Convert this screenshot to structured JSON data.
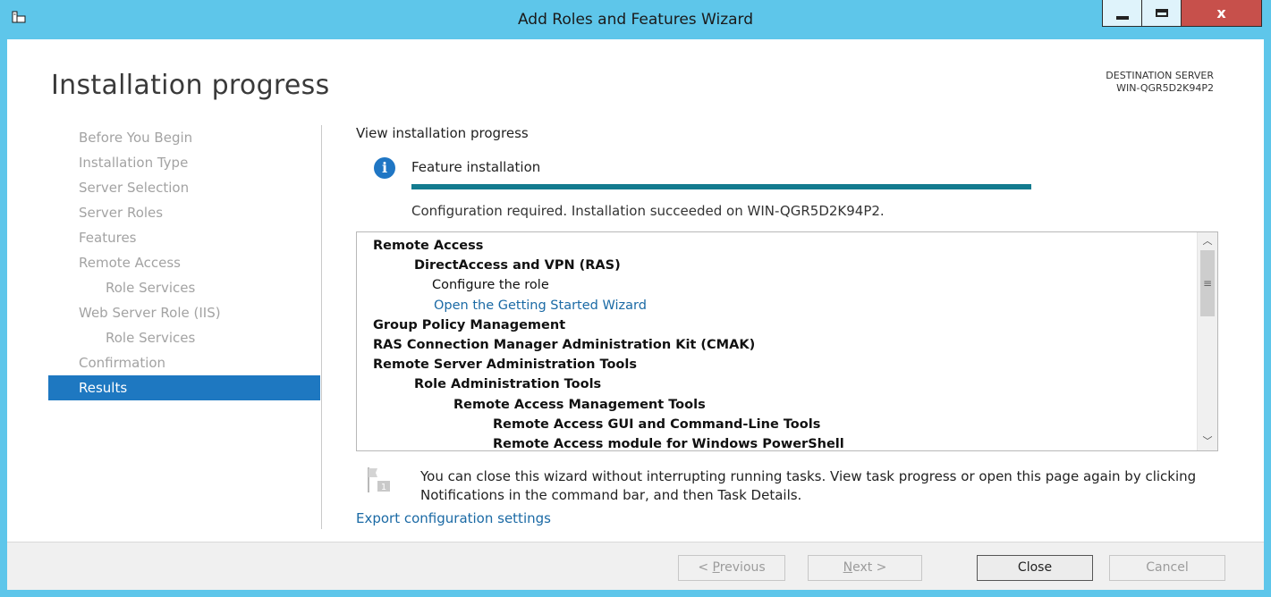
{
  "window": {
    "title": "Add Roles and Features Wizard",
    "close_glyph": "x"
  },
  "header": {
    "page_title": "Installation progress",
    "destination_label": "DESTINATION SERVER",
    "destination_server": "WIN-QGR5D2K94P2"
  },
  "sidebar": {
    "items": [
      {
        "label": "Before You Begin",
        "level": 0,
        "active": false
      },
      {
        "label": "Installation Type",
        "level": 0,
        "active": false
      },
      {
        "label": "Server Selection",
        "level": 0,
        "active": false
      },
      {
        "label": "Server Roles",
        "level": 0,
        "active": false
      },
      {
        "label": "Features",
        "level": 0,
        "active": false
      },
      {
        "label": "Remote Access",
        "level": 0,
        "active": false
      },
      {
        "label": "Role Services",
        "level": 1,
        "active": false
      },
      {
        "label": "Web Server Role (IIS)",
        "level": 0,
        "active": false
      },
      {
        "label": "Role Services",
        "level": 1,
        "active": false
      },
      {
        "label": "Confirmation",
        "level": 0,
        "active": false
      },
      {
        "label": "Results",
        "level": 0,
        "active": true
      }
    ]
  },
  "main": {
    "heading": "View installation progress",
    "info_icon": "info-icon",
    "feature_label": "Feature installation",
    "progress_fraction": 1.0,
    "status_text": "Configuration required. Installation succeeded on WIN-QGR5D2K94P2.",
    "results": [
      {
        "text": "Remote Access",
        "level": 0,
        "bold": true,
        "link": false
      },
      {
        "text": "DirectAccess and VPN (RAS)",
        "level": 1,
        "bold": true,
        "link": false
      },
      {
        "text": "Configure the role",
        "level": 2,
        "bold": false,
        "link": false
      },
      {
        "text": "Open the Getting Started Wizard",
        "level": 2,
        "bold": false,
        "link": true
      },
      {
        "text": "Group Policy Management",
        "level": 0,
        "bold": true,
        "link": false
      },
      {
        "text": "RAS Connection Manager Administration Kit (CMAK)",
        "level": 0,
        "bold": true,
        "link": false
      },
      {
        "text": "Remote Server Administration Tools",
        "level": 0,
        "bold": true,
        "link": false
      },
      {
        "text": "Role Administration Tools",
        "level": 1,
        "bold": true,
        "link": false
      },
      {
        "text": "Remote Access Management Tools",
        "level": 2,
        "bold": true,
        "link": false
      },
      {
        "text": "Remote Access GUI and Command-Line Tools",
        "level": 3,
        "bold": true,
        "link": false
      },
      {
        "text": "Remote Access module for Windows PowerShell",
        "level": 3,
        "bold": true,
        "link": false
      }
    ],
    "note_text": "You can close this wizard without interrupting running tasks. View task progress or open this page again by clicking Notifications in the command bar, and then Task Details.",
    "notification_count": "1",
    "export_link": "Export configuration settings"
  },
  "footer": {
    "previous_label": "< Previous",
    "next_label": "Next >",
    "close_label": "Close",
    "cancel_label": "Cancel"
  },
  "colors": {
    "titlebar": "#5ec6ea",
    "accent": "#1e78c1",
    "progress": "#137b8f",
    "link": "#1b6aa5"
  }
}
